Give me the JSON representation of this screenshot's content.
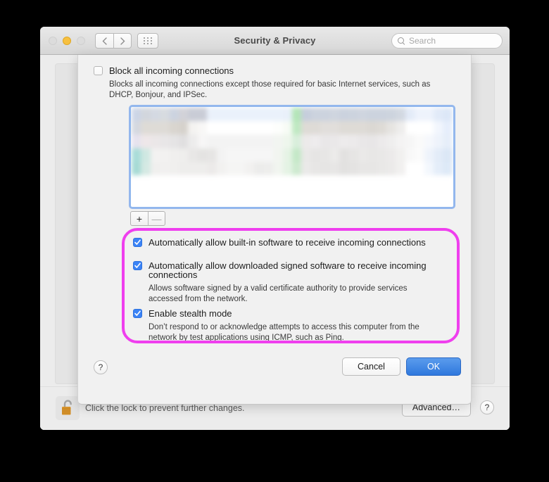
{
  "window": {
    "title": "Security & Privacy",
    "traffic_lights": [
      "close",
      "minimize",
      "zoom"
    ],
    "nav_back_icon": "chevron-left-icon",
    "nav_forward_icon": "chevron-right-icon",
    "grid_icon": "grid-view-icon"
  },
  "search": {
    "placeholder": "Search",
    "icon": "search-icon"
  },
  "sheet": {
    "block_all": {
      "label": "Block all incoming connections",
      "checked": false,
      "description": "Blocks all incoming connections except those required for basic Internet services, such as DHCP, Bonjour, and IPSec."
    },
    "list_controls": {
      "add_label": "+",
      "remove_label": "—"
    },
    "options": [
      {
        "label": "Automatically allow built-in software to receive incoming connections",
        "checked": true,
        "description": ""
      },
      {
        "label": "Automatically allow downloaded signed software to receive incoming connections",
        "checked": true,
        "description": "Allows software signed by a valid certificate authority to provide services accessed from the network."
      },
      {
        "label": "Enable stealth mode",
        "checked": true,
        "description": "Don’t respond to or acknowledge attempts to access this computer from the network by test applications using ICMP, such as Ping."
      }
    ],
    "help_label": "?",
    "cancel_label": "Cancel",
    "ok_label": "OK"
  },
  "bottom_bar": {
    "lock_icon": "unlocked-padlock-icon",
    "lock_caption": "Click the lock to prevent further changes.",
    "advanced_label": "Advanced…",
    "help_label": "?"
  },
  "colors": {
    "accent_blue": "#3b83f6",
    "default_button_blue": "#2f78dd",
    "highlight_magenta": "#ef3fee",
    "focus_ring_blue": "#74a3eb",
    "lock_gold": "#d9962f"
  },
  "blur_grid": {
    "rows": [
      [
        "#ccd5e6",
        "#d2d6dd",
        "#d4d9e2",
        "#d7dbe0",
        "#ccd3e0",
        "#d2d2d8",
        "#c9ccd6",
        "#c9ccd6",
        "#eaf1fb",
        "#eaf1fb",
        "#eaf1fb",
        "#eaf1fb",
        "#eaf1fb",
        "#eaf1fb",
        "#eaf1fb",
        "#eaf1fb",
        "#e9f0fa",
        "#b4e5b8",
        "#c6cedc",
        "#ccd3de",
        "#ccd3de",
        "#cfd5df",
        "#cbd2de",
        "#ccd3de",
        "#cfd5df",
        "#ccd3de",
        "#ccd3de",
        "#cdd4de",
        "#d2d8e1",
        "#e3ebf8",
        "#eef3fc",
        "#eef3fc",
        "#e1eaf8",
        "#dce7f7"
      ],
      [
        "#d4d8e0",
        "#dedbd6",
        "#dedbd6",
        "#dedbd6",
        "#d9d5cf",
        "#d6d2cc",
        "#f4f3f1",
        "#f8f7f6",
        "#ffffff",
        "#ffffff",
        "#ffffff",
        "#ffffff",
        "#ffffff",
        "#ffffff",
        "#ffffff",
        "#fdfefc",
        "#f7fbf5",
        "#bfe9c2",
        "#dedbd6",
        "#dedbd6",
        "#e1dedb",
        "#e1dedb",
        "#dedbd6",
        "#dedbd6",
        "#dedbd6",
        "#dbd8d3",
        "#dedbd6",
        "#e6e4e1",
        "#eeedec",
        "#ffffff",
        "#ffffff",
        "#ffffff",
        "#f2f6fd",
        "#e6eefb"
      ],
      [
        "#e6e2ee",
        "#eee7e9",
        "#ebe7e8",
        "#e8e6e7",
        "#e5e4e5",
        "#e0dfe0",
        "#edecec",
        "#f7f6f6",
        "#f3f3f3",
        "#f3f3f3",
        "#f3f3f3",
        "#f3f3f3",
        "#f3f3f3",
        "#f3f3f3",
        "#f3f3f3",
        "#f2f5f1",
        "#eef6ec",
        "#d8eedb",
        "#eceaea",
        "#eeeced",
        "#e9e7e8",
        "#eae8e9",
        "#edebec",
        "#eceaeb",
        "#e9e7e8",
        "#e8e6e7",
        "#eceaeb",
        "#efeeee",
        "#f4f3f3",
        "#f6f6f6",
        "#fafafa",
        "#f6f8fc",
        "#eef3fb",
        "#e6eef9"
      ],
      [
        "#a8dcd8",
        "#cfe8e2",
        "#f3f2f1",
        "#f2f1f0",
        "#f0efee",
        "#efeeed",
        "#e8e7e6",
        "#e4e3e2",
        "#e6e5e4",
        "#f3f3f3",
        "#f6f6f6",
        "#f6f6f6",
        "#f6f6f6",
        "#f6f6f6",
        "#f6f6f6",
        "#f2f5f0",
        "#e5f3e5",
        "#c4e8c7",
        "#e9e8e7",
        "#e6e5e4",
        "#e7e6e5",
        "#ecebea",
        "#e2e1e0",
        "#e6e5e4",
        "#eae9e8",
        "#e8e7e6",
        "#e9e8e7",
        "#eceaea",
        "#f1f0ef",
        "#f8f8f8",
        "#fbfbfb",
        "#eef3fb",
        "#e3ecf8",
        "#dbe7f6"
      ],
      [
        "#a5dad4",
        "#d4e9e3",
        "#f0efee",
        "#f1f0ef",
        "#f0efee",
        "#eeedec",
        "#eeedec",
        "#eeedec",
        "#eceae9",
        "#f2f1f0",
        "#f5f5f4",
        "#f5f5f4",
        "#f2f1f0",
        "#ececeb",
        "#ededec",
        "#f1f5ef",
        "#e4f3e4",
        "#cdeacf",
        "#eae9e8",
        "#e7e6e5",
        "#e6e5e4",
        "#e7e6e5",
        "#e2e1e0",
        "#e4e3e2",
        "#e7e6e5",
        "#e7e6e5",
        "#e9e8e7",
        "#ebeae9",
        "#f1f0ef",
        "#ffffff",
        "#ffffff",
        "#f3f7fd",
        "#e4edf9",
        "#dde9f7"
      ]
    ]
  }
}
